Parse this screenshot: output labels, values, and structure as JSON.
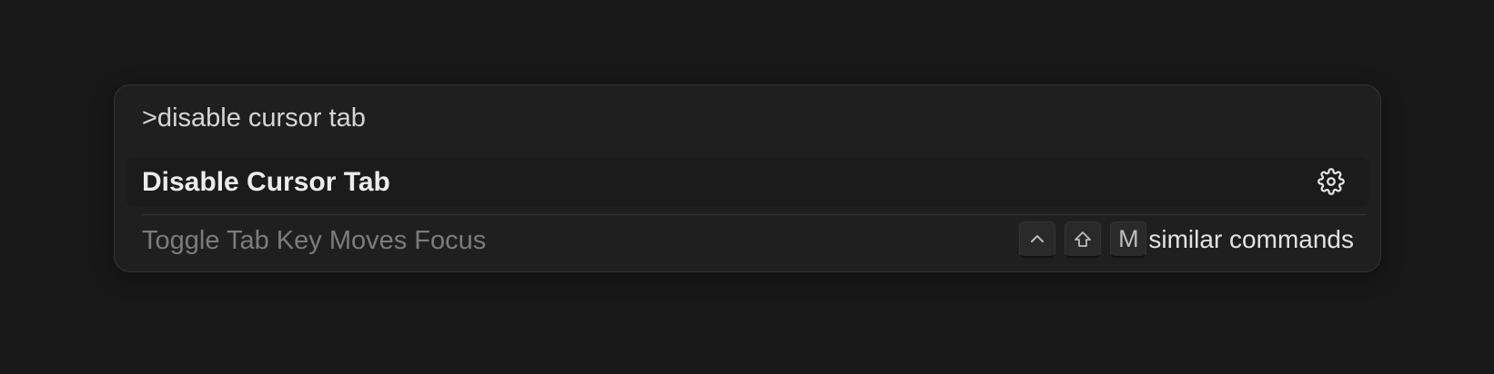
{
  "search": {
    "value": ">disable cursor tab"
  },
  "results": [
    {
      "label": "Disable Cursor Tab",
      "icon": "gear-icon"
    },
    {
      "label": "Toggle Tab Key Moves Focus"
    }
  ],
  "shortcut": {
    "keys": [
      "ctrl-icon",
      "shift-icon",
      "M"
    ],
    "hint": "similar commands"
  },
  "colors": {
    "background": "#181818",
    "panel": "#1f1f1f",
    "text_primary": "#ececec",
    "text_muted": "#7c7c7c"
  }
}
